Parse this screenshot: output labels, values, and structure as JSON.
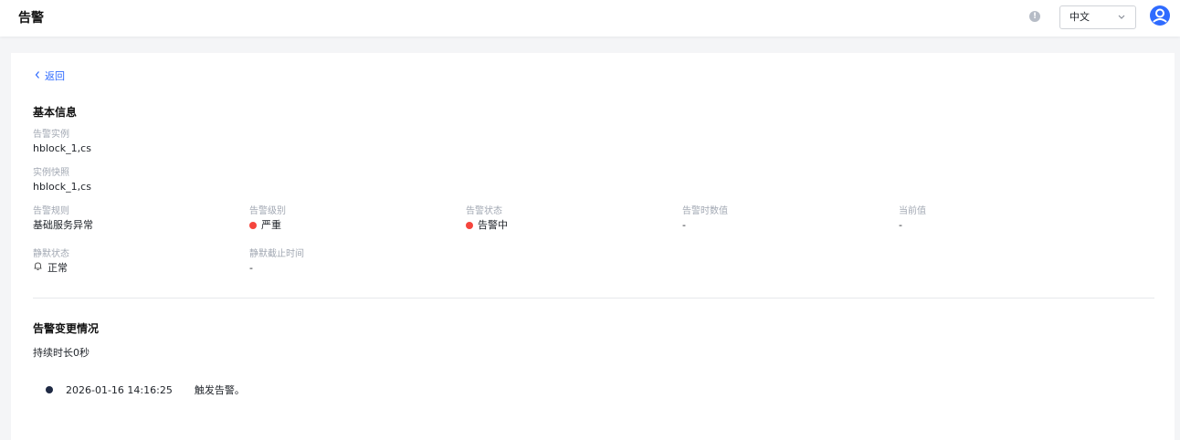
{
  "header": {
    "title": "告警",
    "language": "中文",
    "icons": {
      "info": "info-icon",
      "chevron": "chevron-down-icon",
      "avatar": "user-avatar-icon"
    }
  },
  "back": {
    "label": "返回",
    "icon": "chevron-left-icon"
  },
  "basic_info": {
    "title": "基本信息",
    "alarm_instance": {
      "label": "告警实例",
      "value": "hblock_1,cs"
    },
    "instance_snapshot": {
      "label": "实例快照",
      "value": "hblock_1,cs"
    },
    "alarm_rule": {
      "label": "告警规则",
      "value": "基础服务异常"
    },
    "alarm_level": {
      "label": "告警级别",
      "value": "严重",
      "color": "#f5453d"
    },
    "alarm_status": {
      "label": "告警状态",
      "value": "告警中",
      "color": "#f5453d"
    },
    "alarm_time_value": {
      "label": "告警时数值",
      "value": "-"
    },
    "current_value": {
      "label": "当前值",
      "value": "-"
    },
    "mute_status": {
      "label": "静默状态",
      "value": "正常",
      "icon": "bell-icon"
    },
    "mute_end_time": {
      "label": "静默截止时间",
      "value": "-"
    }
  },
  "changes": {
    "title": "告警变更情况",
    "duration": "持续时长0秒",
    "events": [
      {
        "time": "2026-01-16 14:16:25",
        "text": "触发告警。"
      }
    ]
  }
}
